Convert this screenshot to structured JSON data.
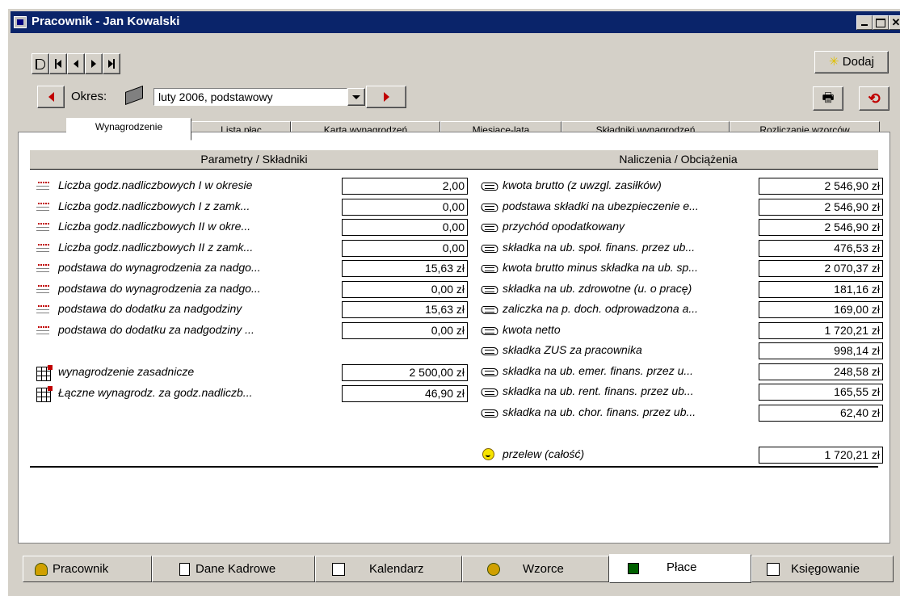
{
  "window": {
    "title": "Pracownik - Jan Kowalski",
    "controls": [
      "_",
      "□",
      "×"
    ]
  },
  "toolbar": {
    "nav_buttons": [
      "D",
      "I◀",
      "◀",
      "▶",
      "▶I"
    ],
    "add_label": "Dodaj",
    "period_label": "Okres:",
    "period_value": "luty 2006, podstawowy"
  },
  "tabs": [
    {
      "label": "Wynagrodzenie",
      "active": true
    },
    {
      "label": "Lista płac",
      "active": false
    },
    {
      "label": "Karta wynagrodzeń",
      "active": false
    },
    {
      "label": "Miesiące-lata",
      "active": false
    },
    {
      "label": "Składniki wynagrodzeń",
      "active": false
    },
    {
      "label": "Rozliczanie wzorców",
      "active": false
    }
  ],
  "left": {
    "header": "Parametry / Składniki",
    "rows": [
      {
        "icon": "list-icon",
        "label": "Liczba godz.nadliczbowych I w okresie",
        "value": "2,00"
      },
      {
        "icon": "list-icon",
        "label": "Liczba godz.nadliczbowych I z zamk...",
        "value": "0,00"
      },
      {
        "icon": "list-icon",
        "label": "Liczba godz.nadliczbowych II w okre...",
        "value": "0,00"
      },
      {
        "icon": "list-icon",
        "label": "Liczba godz.nadliczbowych II z zamk...",
        "value": "0,00"
      },
      {
        "icon": "list-icon",
        "label": "podstawa do wynagrodzenia za nadgo...",
        "value": "15,63 zł"
      },
      {
        "icon": "list-icon",
        "label": "podstawa do wynagrodzenia za nadgo...",
        "value": "0,00 zł"
      },
      {
        "icon": "list-icon",
        "label": "podstawa do dodatku za nadgodziny",
        "value": "15,63 zł"
      },
      {
        "icon": "list-icon",
        "label": "podstawa do dodatku za nadgodziny ...",
        "value": "0,00 zł"
      }
    ],
    "rows2": [
      {
        "icon": "grid-icon",
        "label": "wynagrodzenie zasadnicze",
        "value": "2 500,00 zł"
      },
      {
        "icon": "grid-icon",
        "label": "Łączne wynagrodz. za godz.nadliczb...",
        "value": "46,90 zł"
      }
    ]
  },
  "right": {
    "header": "Naliczenia / Obciążenia",
    "rows": [
      {
        "icon": "hand-icon",
        "label": "kwota brutto (z uwzgl. zasiłków)",
        "value": "2 546,90 zł"
      },
      {
        "icon": "hand-icon",
        "label": "podstawa składki na ubezpieczenie e...",
        "value": "2 546,90 zł"
      },
      {
        "icon": "hand-icon",
        "label": "przychód opodatkowany",
        "value": "2 546,90 zł"
      },
      {
        "icon": "hand-icon",
        "label": "składka na ub. społ. finans. przez ub...",
        "value": "476,53 zł"
      },
      {
        "icon": "hand-icon",
        "label": "kwota brutto minus składka na ub. sp...",
        "value": "2 070,37 zł"
      },
      {
        "icon": "hand-icon",
        "label": "składka na ub. zdrowotne (u. o pracę)",
        "value": "181,16 zł"
      },
      {
        "icon": "hand-icon",
        "label": "zaliczka na p. doch. odprowadzona a...",
        "value": "169,00 zł"
      },
      {
        "icon": "hand-icon",
        "label": "kwota netto",
        "value": "1 720,21 zł"
      },
      {
        "icon": "hand-icon",
        "label": "składka ZUS za pracownika",
        "value": "998,14 zł"
      },
      {
        "icon": "hand-icon",
        "label": "składka na ub. emer. finans. przez u...",
        "value": "248,58 zł"
      },
      {
        "icon": "hand-icon",
        "label": "składka na ub. rent. finans. przez ub...",
        "value": "165,55 zł"
      },
      {
        "icon": "hand-icon",
        "label": "składka na ub. chor. finans. przez ub...",
        "value": "62,40 zł"
      }
    ],
    "transfer": {
      "icon": "smiley-icon",
      "label": "przelew (całość)",
      "value": "1 720,21 zł"
    }
  },
  "bottom_tabs": [
    {
      "label": "Pracownik",
      "icon": "person-icon",
      "active": false
    },
    {
      "label": "Dane Kadrowe",
      "icon": "document-icon",
      "active": false
    },
    {
      "label": "Kalendarz",
      "icon": "calendar-icon",
      "active": false
    },
    {
      "label": "Wzorce",
      "icon": "people-icon",
      "active": false
    },
    {
      "label": "Płace",
      "icon": "calculator-icon",
      "active": true
    },
    {
      "label": "Księgowanie",
      "icon": "ledger-icon",
      "active": false
    }
  ]
}
